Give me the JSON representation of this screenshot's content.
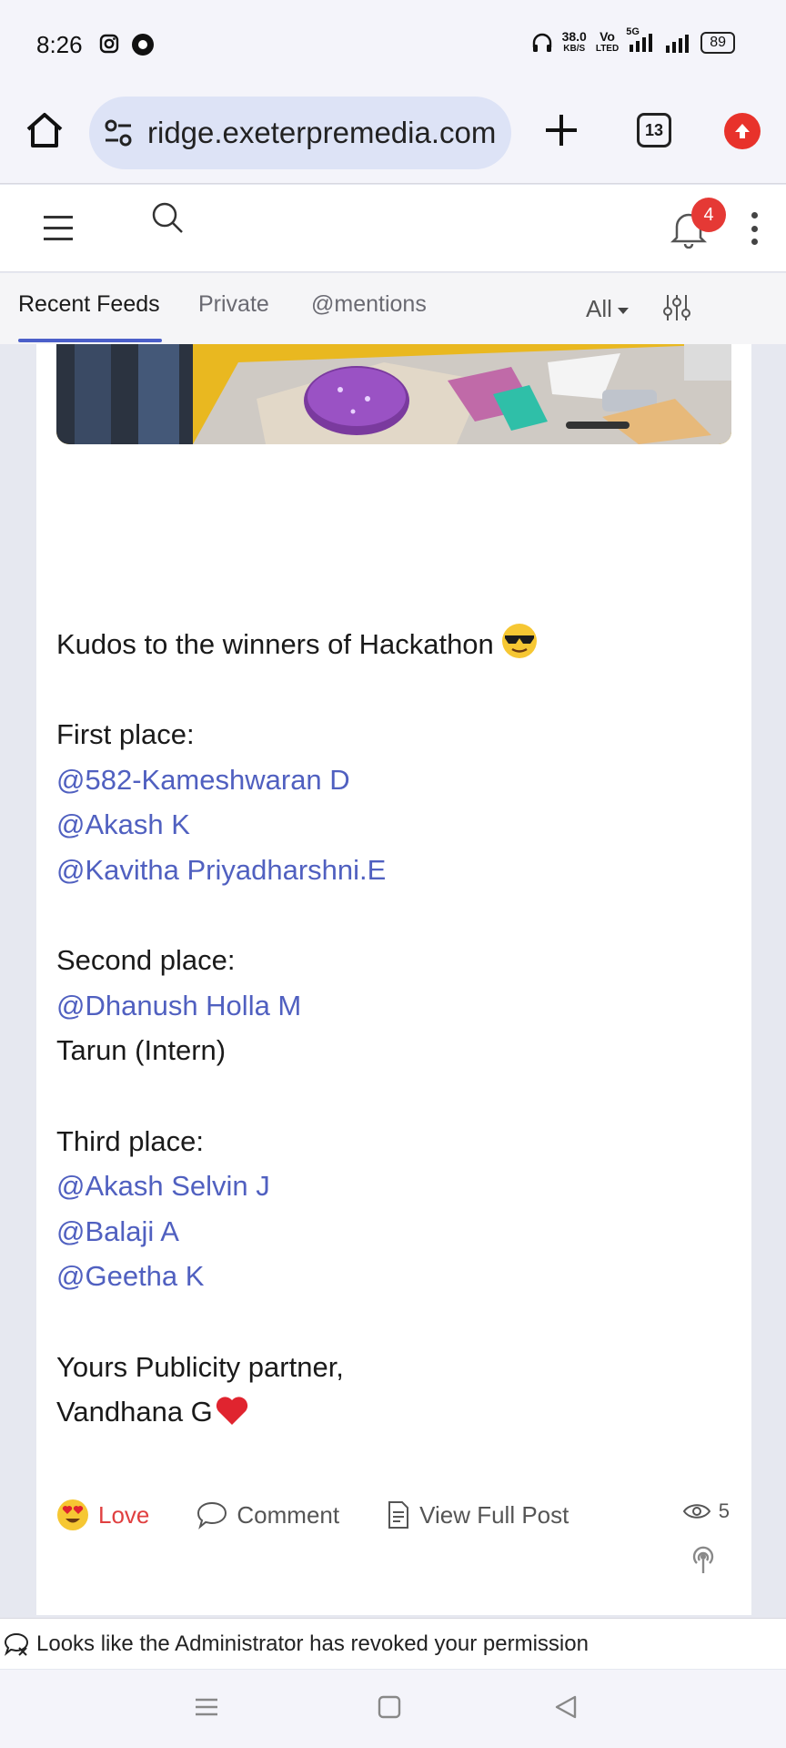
{
  "status_bar": {
    "time": "8:26",
    "speed_value": "38.0",
    "speed_unit": "KB/S",
    "volte": "Vo",
    "volte_sub": "LTED",
    "network": "5G",
    "battery": "89"
  },
  "browser": {
    "url": "ridge.exeterpremedia.com",
    "tab_count": "13"
  },
  "header": {
    "notification_count": "4"
  },
  "tabs": [
    {
      "label": "Recent Feeds",
      "active": true
    },
    {
      "label": "Private",
      "active": false
    },
    {
      "label": "@mentions",
      "active": false
    }
  ],
  "filter": {
    "selected": "All"
  },
  "post": {
    "headline": "Kudos to the winners of Hackathon",
    "first_heading": "First place:",
    "first": [
      "@582-Kameshwaran D",
      "@Akash K",
      "@Kavitha Priyadharshni.E"
    ],
    "second_heading": "Second place:",
    "second_mention": "@Dhanush Holla M",
    "second_plain": "Tarun (Intern)",
    "third_heading": "Third place:",
    "third": [
      "@Akash Selvin J",
      "@Balaji A",
      "@Geetha K"
    ],
    "signoff": "Yours Publicity partner,",
    "author": "Vandhana G"
  },
  "actions": {
    "love": "Love",
    "comment": "Comment",
    "view_full": "View Full Post",
    "views": "5"
  },
  "toast": {
    "message": "Looks like the Administrator has revoked your permission"
  },
  "colors": {
    "accent": "#4b5fc9",
    "mention": "#5060c0",
    "love": "#e04040",
    "badge": "#e53935"
  }
}
